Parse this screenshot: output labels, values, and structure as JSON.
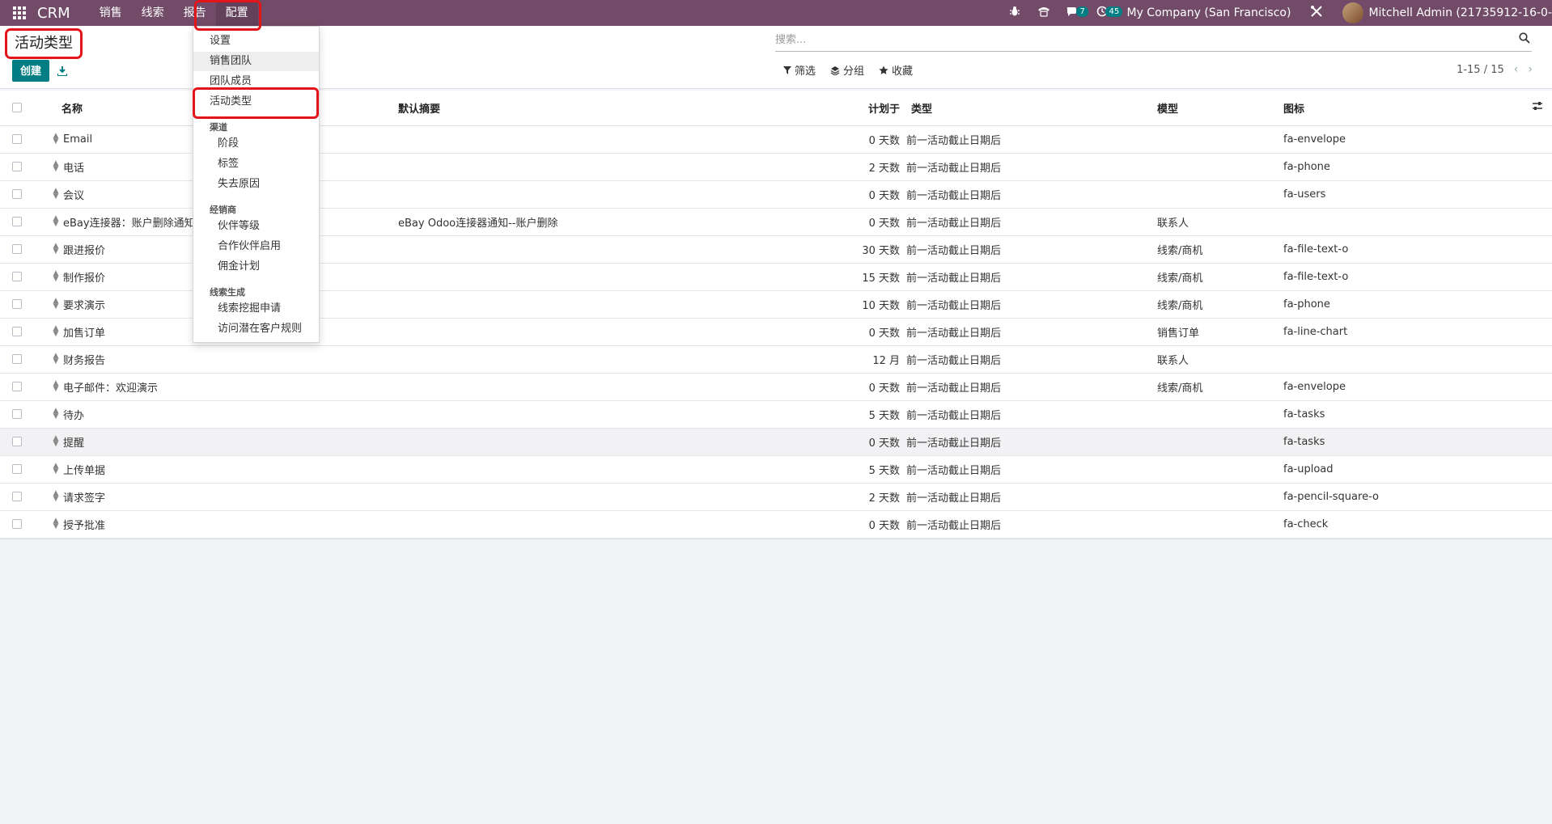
{
  "navbar": {
    "app_name": "CRM",
    "menu": [
      "销售",
      "线索",
      "报告",
      "配置"
    ],
    "chat_badge": "7",
    "activity_badge": "45",
    "company": "My Company (San Francisco)",
    "user": "Mitchell Admin (21735912-16-0-"
  },
  "breadcrumb": "活动类型",
  "toolbar": {
    "create_label": "创建"
  },
  "search": {
    "placeholder": "搜索..."
  },
  "filters": {
    "filter": "筛选",
    "group": "分组",
    "favorites": "收藏"
  },
  "pager": "1-15 / 15",
  "dropdown": {
    "items": [
      "设置",
      "销售团队",
      "团队成员",
      "活动类型"
    ],
    "section_pipeline": "渠道",
    "pipeline_items": [
      "阶段",
      "标签",
      "失去原因"
    ],
    "section_partner": "经销商",
    "partner_items": [
      "伙伴等级",
      "合作伙伴启用",
      "佣金计划"
    ],
    "section_lead": "线索生成",
    "lead_items": [
      "线索挖掘申请",
      "访问潜在客户规则"
    ]
  },
  "table": {
    "columns": [
      "名称",
      "默认摘要",
      "计划于",
      "类型",
      "模型",
      "图标"
    ],
    "rows": [
      {
        "name": "Email",
        "summary": "",
        "plan": "0 天数",
        "type": "前一活动截止日期后",
        "model": "",
        "icon": "fa-envelope"
      },
      {
        "name": "电话",
        "summary": "",
        "plan": "2 天数",
        "type": "前一活动截止日期后",
        "model": "",
        "icon": "fa-phone"
      },
      {
        "name": "会议",
        "summary": "",
        "plan": "0 天数",
        "type": "前一活动截止日期后",
        "model": "",
        "icon": "fa-users"
      },
      {
        "name": "eBay连接器：账户删除通知",
        "summary": "eBay Odoo连接器通知--账户删除",
        "plan": "0 天数",
        "type": "前一活动截止日期后",
        "model": "联系人",
        "icon": ""
      },
      {
        "name": "跟进报价",
        "summary": "",
        "plan": "30 天数",
        "type": "前一活动截止日期后",
        "model": "线索/商机",
        "icon": "fa-file-text-o"
      },
      {
        "name": "制作报价",
        "summary": "",
        "plan": "15 天数",
        "type": "前一活动截止日期后",
        "model": "线索/商机",
        "icon": "fa-file-text-o"
      },
      {
        "name": "要求演示",
        "summary": "",
        "plan": "10 天数",
        "type": "前一活动截止日期后",
        "model": "线索/商机",
        "icon": "fa-phone"
      },
      {
        "name": "加售订单",
        "summary": "",
        "plan": "0 天数",
        "type": "前一活动截止日期后",
        "model": "销售订单",
        "icon": "fa-line-chart"
      },
      {
        "name": "财务报告",
        "summary": "",
        "plan": "12 月",
        "type": "前一活动截止日期后",
        "model": "联系人",
        "icon": ""
      },
      {
        "name": "电子邮件：欢迎演示",
        "summary": "",
        "plan": "0 天数",
        "type": "前一活动截止日期后",
        "model": "线索/商机",
        "icon": "fa-envelope"
      },
      {
        "name": "待办",
        "summary": "",
        "plan": "5 天数",
        "type": "前一活动截止日期后",
        "model": "",
        "icon": "fa-tasks"
      },
      {
        "name": "提醒",
        "summary": "",
        "plan": "0 天数",
        "type": "前一活动截止日期后",
        "model": "",
        "icon": "fa-tasks"
      },
      {
        "name": "上传单据",
        "summary": "",
        "plan": "5 天数",
        "type": "前一活动截止日期后",
        "model": "",
        "icon": "fa-upload"
      },
      {
        "name": "请求签字",
        "summary": "",
        "plan": "2 天数",
        "type": "前一活动截止日期后",
        "model": "",
        "icon": "fa-pencil-square-o"
      },
      {
        "name": "授予批准",
        "summary": "",
        "plan": "0 天数",
        "type": "前一活动截止日期后",
        "model": "",
        "icon": "fa-check"
      }
    ]
  },
  "colors": {
    "navbar": "#714B67",
    "primary": "#017e84",
    "annotation": "#e3141a"
  }
}
